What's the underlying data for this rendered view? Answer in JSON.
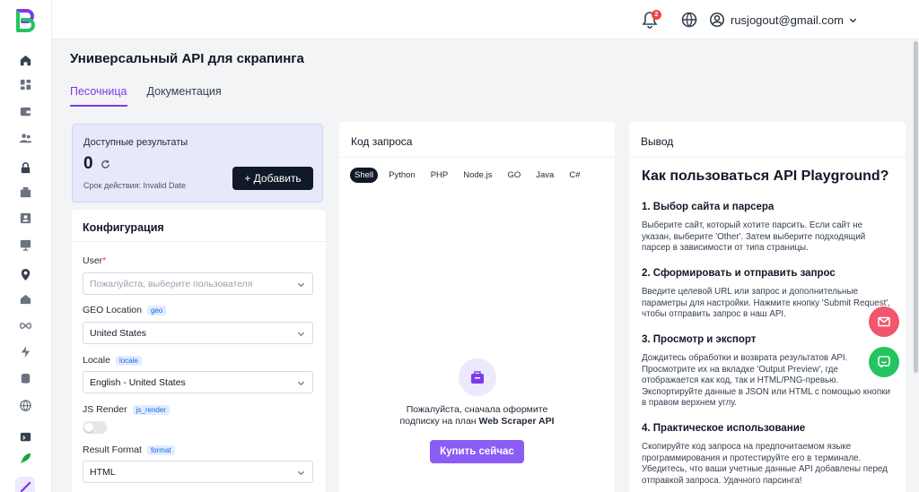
{
  "header": {
    "notification_count": "2",
    "user_email": "rusjogout@gmail.com"
  },
  "page": {
    "title": "Универсальный API для скрапинга",
    "tabs": [
      {
        "label": "Песочница",
        "active": true
      },
      {
        "label": "Документация",
        "active": false
      }
    ]
  },
  "results": {
    "title": "Доступные результаты",
    "count": "0",
    "expires": "Срок действия: Invalid Date",
    "add_label": "+ Добавить"
  },
  "config": {
    "title": "Конфигурация",
    "user_label": "User",
    "user_required": "*",
    "user_placeholder": "Пожалуйста, выберите пользователя",
    "geo_label": "GEO Location",
    "geo_chip": "geo",
    "geo_value": "United States",
    "locale_label": "Locale",
    "locale_chip": "locale",
    "locale_value": "English - United States",
    "js_label": "JS Render",
    "js_chip": "js_render",
    "js_enabled": false,
    "format_label": "Result Format",
    "format_chip": "format",
    "format_value": "HTML"
  },
  "code": {
    "title": "Код запроса",
    "languages": [
      "Shell",
      "Python",
      "PHP",
      "Node.js",
      "GO",
      "Java",
      "C#"
    ],
    "active_language": "Shell",
    "message_line1": "Пожалуйста, сначала оформите",
    "message_line2_prefix": "подписку на план ",
    "message_line2_plan": "Web Scraper API",
    "buy_label": "Купить сейчас"
  },
  "output": {
    "title": "Вывод",
    "heading": "Как пользоваться API Playground?",
    "sections": [
      {
        "heading": "1. Выбор сайта и парсера",
        "text": "Выберите сайт, который хотите парсить. Если сайт не указан, выберите 'Other'. Затем выберите подходящий парсер в зависимости от типа страницы."
      },
      {
        "heading": "2. Сформировать и отправить запрос",
        "text": "Введите целевой URL или запрос и дополнительные параметры для настройки. Нажмите кнопку 'Submit Request', чтобы отправить запрос в наш API."
      },
      {
        "heading": "3. Просмотр и экспорт",
        "text": "Дождитесь обработки и возврата результатов API. Просмотрите их на вкладке 'Output Preview', где отображается как код, так и HTML/PNG-превью. Экспортируйте данные в JSON или HTML с помощью кнопки в правом верхнем углу."
      },
      {
        "heading": "4. Практическое использование",
        "text": "Скопируйте код запроса на предпочитаемом языке программирования и протестируйте его в терминале. Убедитесь, что ваши учетные данные API добавлены перед отправкой запроса. Удачного парсинга!"
      }
    ]
  },
  "colors": {
    "accent": "#7c3aed",
    "buy_button": "#8b5cf6",
    "dark_button": "#111827",
    "mail_fab": "#f0566c",
    "chat_fab": "#22c55e"
  }
}
